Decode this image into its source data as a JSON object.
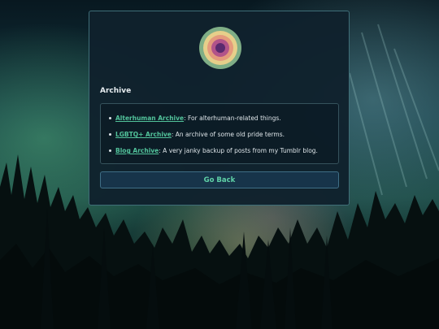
{
  "archive": {
    "title": "Archive",
    "items": [
      {
        "link": "Alterhuman Archive",
        "desc": ": For alterhuman-related things."
      },
      {
        "link": "LGBTQ+ Archive",
        "desc": ": An archive of some old pride terms."
      },
      {
        "link": "Blog Archive",
        "desc": ": A very janky backup of posts from my Tumblr blog."
      }
    ],
    "go_back_label": "Go Back"
  },
  "colors": {
    "accent": "#52c39b",
    "card_border": "#3f6e78",
    "button_bg": "#17344a"
  },
  "icons": [
    "concentric-circle-logo-icon"
  ]
}
